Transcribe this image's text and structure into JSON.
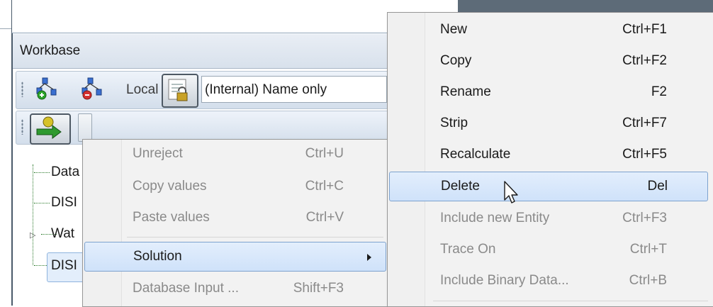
{
  "panel": {
    "title": "Workbase",
    "local_label": "Local",
    "filter_value": "(Internal) Name only"
  },
  "tree": {
    "items": [
      "Data",
      "DISI",
      "Wat",
      "DISI"
    ]
  },
  "menu1": {
    "items": [
      {
        "label": "Unreject",
        "shortcut": "Ctrl+U"
      },
      {
        "label": "Copy values",
        "shortcut": "Ctrl+C"
      },
      {
        "label": "Paste values",
        "shortcut": "Ctrl+V"
      },
      {
        "label": "Solution",
        "shortcut": ""
      },
      {
        "label": "Database Input ...",
        "shortcut": "Shift+F3"
      }
    ]
  },
  "menu2": {
    "items": [
      {
        "label": "New",
        "shortcut": "Ctrl+F1"
      },
      {
        "label": "Copy",
        "shortcut": "Ctrl+F2"
      },
      {
        "label": "Rename",
        "shortcut": "F2"
      },
      {
        "label": "Strip",
        "shortcut": "Ctrl+F7"
      },
      {
        "label": "Recalculate",
        "shortcut": "Ctrl+F5"
      },
      {
        "label": "Delete",
        "shortcut": "Del"
      },
      {
        "label": "Include new Entity",
        "shortcut": "Ctrl+F3"
      },
      {
        "label": "Trace On",
        "shortcut": "Ctrl+T"
      },
      {
        "label": "Include Binary Data...",
        "shortcut": "Ctrl+B"
      }
    ]
  },
  "icons": {
    "add_entity": "add-entity-icon",
    "remove_entity": "remove-entity-icon",
    "lock_filter": "lock-filter-icon",
    "run_arrow": "run-arrow-icon",
    "submenu_arrow": "chevron-right-icon",
    "cursor": "mouse-pointer-icon"
  },
  "colors": {
    "highlight": "#cfe2fa",
    "highlight_border": "#7da2ce",
    "disabled_text": "#8a8a8a",
    "toolbar": "#d3deeb"
  }
}
